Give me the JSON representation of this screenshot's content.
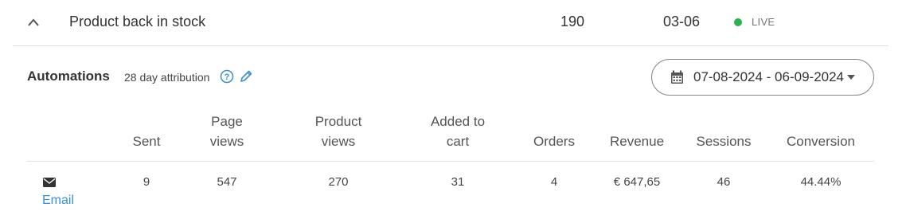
{
  "row": {
    "title": "Product back in stock",
    "count": "190",
    "date": "03-06",
    "status": "LIVE"
  },
  "automations": {
    "title": "Automations",
    "attribution": "28 day attribution",
    "date_range": "07-08-2024 - 06-09-2024"
  },
  "table": {
    "headers": {
      "sent": "Sent",
      "page_views_1": "Page",
      "page_views_2": "views",
      "product_views_1": "Product",
      "product_views_2": "views",
      "added_1": "Added to",
      "added_2": "cart",
      "orders": "Orders",
      "revenue": "Revenue",
      "sessions": "Sessions",
      "conversion": "Conversion"
    },
    "rows": [
      {
        "channel": "Email",
        "sent": "9",
        "page_views": "547",
        "product_views": "270",
        "added_to_cart": "31",
        "orders": "4",
        "revenue": "€ 647,65",
        "sessions": "46",
        "conversion": "44.44%"
      }
    ]
  },
  "colors": {
    "live": "#2bb24c",
    "link": "#3b8fd3",
    "icon_blue": "#3b8fd3"
  },
  "icons": {
    "collapse": "chevron-up-icon",
    "help": "question-circle-icon",
    "edit": "pencil-icon",
    "calendar": "calendar-icon",
    "dropdown": "caret-down-icon",
    "channel": "envelope-icon"
  }
}
